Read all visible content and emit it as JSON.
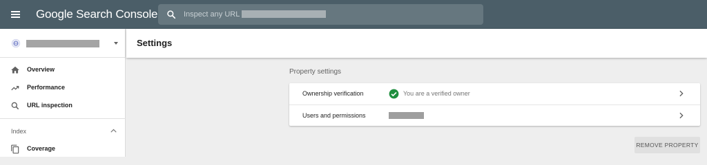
{
  "app": {
    "title": "Google Search Console"
  },
  "search": {
    "placeholder": "Inspect any URL in"
  },
  "sidebar": {
    "items": [
      {
        "label": "Overview",
        "icon": "home-icon"
      },
      {
        "label": "Performance",
        "icon": "trending-icon"
      },
      {
        "label": "URL inspection",
        "icon": "search-icon"
      }
    ],
    "index_section": {
      "label": "Index",
      "items": [
        {
          "label": "Coverage",
          "icon": "copy-icon"
        }
      ]
    }
  },
  "page": {
    "title": "Settings"
  },
  "property_settings": {
    "heading": "Property settings",
    "rows": [
      {
        "label": "Ownership verification",
        "status": "You are a verified owner"
      },
      {
        "label": "Users and permissions"
      }
    ]
  },
  "actions": {
    "remove_property": "REMOVE PROPERTY"
  },
  "colors": {
    "topbar": "#4b5e68",
    "verified": "#1e8e3e"
  }
}
